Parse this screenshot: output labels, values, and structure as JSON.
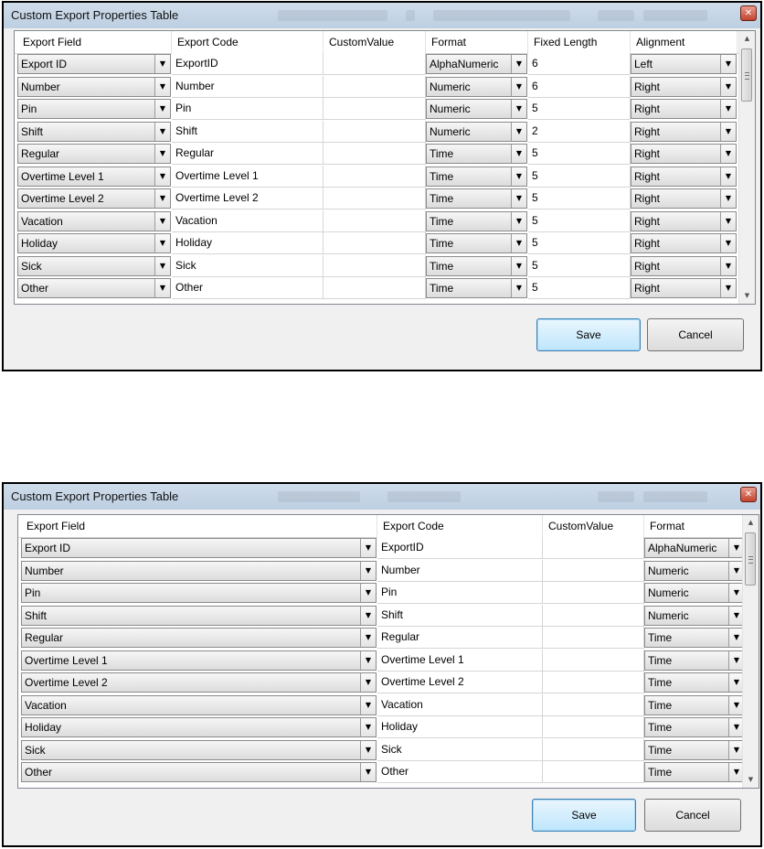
{
  "title": "Custom Export Properties Table",
  "close_glyph": "✕",
  "buttons": {
    "save": "Save",
    "cancel": "Cancel"
  },
  "icons": {
    "dropdown": "chevron-down-icon",
    "close": "close-icon",
    "scroll_up": "scroll-up-icon",
    "scroll_down": "scroll-down-icon"
  },
  "colors": {
    "title_bar": "#c4d5e7",
    "close_button": "#c8452f",
    "default_button": "#bee6fd",
    "window_bg": "#f0f0f0"
  },
  "dialogs": [
    {
      "columns": [
        {
          "key": "field",
          "label": "Export Field",
          "type": "combo"
        },
        {
          "key": "code",
          "label": "Export Code",
          "type": "text"
        },
        {
          "key": "custom",
          "label": "CustomValue",
          "type": "text"
        },
        {
          "key": "format",
          "label": "Format",
          "type": "combo"
        },
        {
          "key": "length",
          "label": "Fixed Length",
          "type": "text"
        },
        {
          "key": "align",
          "label": "Alignment",
          "type": "combo"
        }
      ]
    },
    {
      "columns": [
        {
          "key": "field",
          "label": "Export Field",
          "type": "combo"
        },
        {
          "key": "code",
          "label": "Export Code",
          "type": "text"
        },
        {
          "key": "custom",
          "label": "CustomValue",
          "type": "text"
        },
        {
          "key": "format",
          "label": "Format",
          "type": "combo"
        }
      ]
    }
  ],
  "rows": [
    {
      "field": "Export ID",
      "code": "ExportID",
      "custom": "",
      "format": "AlphaNumeric",
      "length": "6",
      "align": "Left"
    },
    {
      "field": "Number",
      "code": "Number",
      "custom": "",
      "format": "Numeric",
      "length": "6",
      "align": "Right"
    },
    {
      "field": "Pin",
      "code": "Pin",
      "custom": "",
      "format": "Numeric",
      "length": "5",
      "align": "Right"
    },
    {
      "field": "Shift",
      "code": "Shift",
      "custom": "",
      "format": "Numeric",
      "length": "2",
      "align": "Right"
    },
    {
      "field": "Regular",
      "code": "Regular",
      "custom": "",
      "format": "Time",
      "length": "5",
      "align": "Right"
    },
    {
      "field": "Overtime Level 1",
      "code": "Overtime Level 1",
      "custom": "",
      "format": "Time",
      "length": "5",
      "align": "Right"
    },
    {
      "field": "Overtime Level 2",
      "code": "Overtime Level 2",
      "custom": "",
      "format": "Time",
      "length": "5",
      "align": "Right"
    },
    {
      "field": "Vacation",
      "code": "Vacation",
      "custom": "",
      "format": "Time",
      "length": "5",
      "align": "Right"
    },
    {
      "field": "Holiday",
      "code": "Holiday",
      "custom": "",
      "format": "Time",
      "length": "5",
      "align": "Right"
    },
    {
      "field": "Sick",
      "code": "Sick",
      "custom": "",
      "format": "Time",
      "length": "5",
      "align": "Right"
    },
    {
      "field": "Other",
      "code": "Other",
      "custom": "",
      "format": "Time",
      "length": "5",
      "align": "Right"
    }
  ]
}
